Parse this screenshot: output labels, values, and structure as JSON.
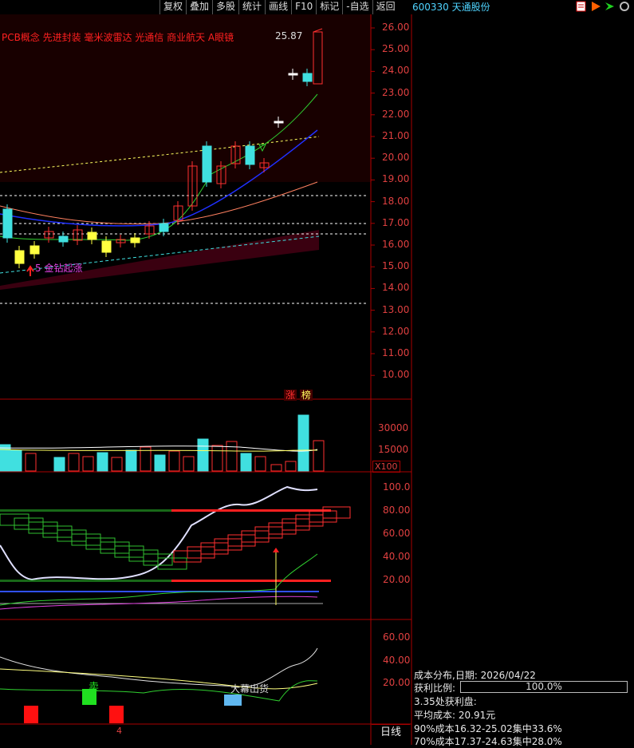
{
  "toolbar": [
    "复权",
    "叠加",
    "多股",
    "统计",
    "画线",
    "F10",
    "标记",
    "-自选",
    "返回"
  ],
  "stock": {
    "code": "600330",
    "name": "天通股份"
  },
  "concepts": "PCB概念 先进封装 毫米波雷达 光通信 商业航天 A眼镜",
  "price_axis": [
    "26.00",
    "25.00",
    "24.00",
    "23.00",
    "22.00",
    "21.00",
    "20.00",
    "19.00",
    "18.00",
    "17.00",
    "16.00",
    "15.00",
    "14.00",
    "13.00",
    "12.00",
    "11.00",
    "10.00"
  ],
  "high_label": "25.87",
  "signal_label": "5 金钻起涨",
  "limit_badge": [
    "涨",
    "榜"
  ],
  "volume_axis": [
    "30000",
    "15000"
  ],
  "volume_unit": "X100",
  "kdj_axis": [
    "100.0",
    "80.00",
    "60.00",
    "40.00",
    "20.00"
  ],
  "bottom_axis": [
    "60.00",
    "40.00",
    "20.00"
  ],
  "sell_label": "卖",
  "big_exit_label": "大幕出货",
  "date_marker": "4",
  "period_tab": "日线",
  "cost": {
    "title": "成本分布,日期: 2026/04/22",
    "profit_label": "获利比例:",
    "profit_value": "100.0%",
    "profit_at": "3.35处获利盘:",
    "avg_cost": "平均成本: 20.91元",
    "c90": "90%成本16.32-25.02集中33.6%",
    "c70": "70%成本17.37-24.63集中28.0%"
  },
  "colors": {
    "up": "#ff3030",
    "down": "#40e0e0",
    "axis": "#a00000",
    "yellow": "#ffff00"
  }
}
